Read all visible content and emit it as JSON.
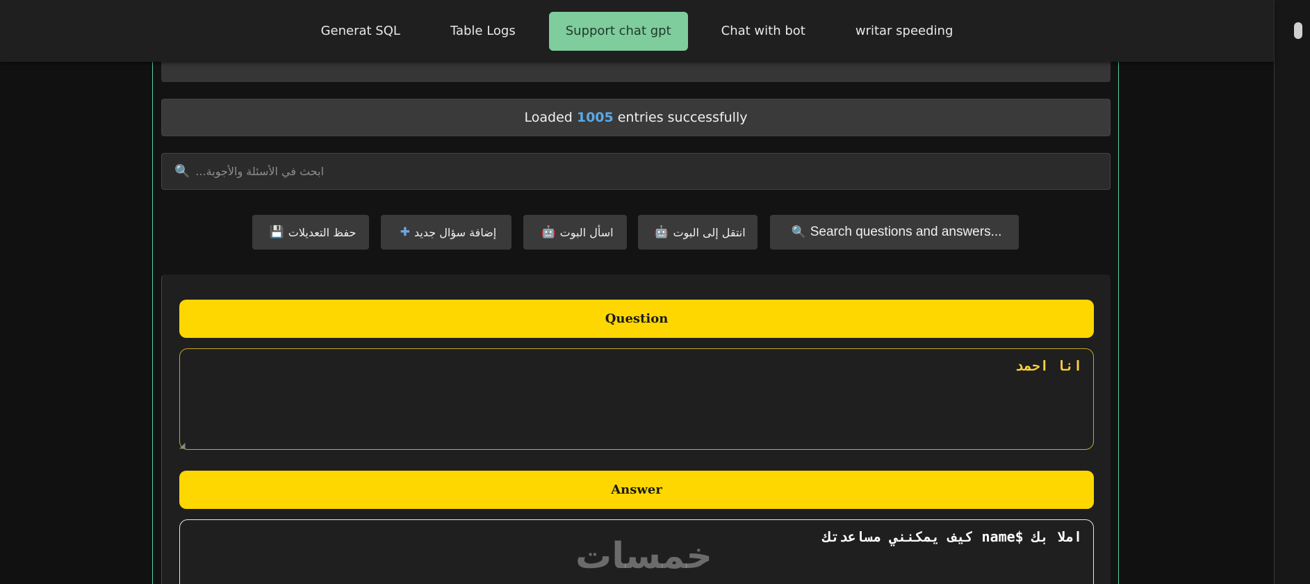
{
  "nav": {
    "tabs": [
      {
        "label": "Generat SQL",
        "active": false
      },
      {
        "label": "Table Logs",
        "active": false
      },
      {
        "label": "Support chat gpt",
        "active": true
      },
      {
        "label": "Chat with bot",
        "active": false
      },
      {
        "label": "writar speeding",
        "active": false
      }
    ]
  },
  "status": {
    "prefix": "Loaded",
    "count": "1005",
    "suffix": "entries successfully"
  },
  "search": {
    "placeholder": "ابحث في الأسئلة والأجوبة...",
    "icon": "search-icon"
  },
  "toolbar": {
    "search_label": "Search questions and answers...",
    "goto_bot_label": "انتقل إلى البوت",
    "ask_bot_label": "اسأل البوت",
    "add_question_label": "إضافة سؤال جديد",
    "save_label": "حفظ التعديلات"
  },
  "entry": {
    "question_header": "Question",
    "question_text": "انا احمد",
    "answer_header": "Answer",
    "answer_text": "املا بك $name كيف يمكنني مساعدتك"
  },
  "watermark": {
    "text": "خمسات"
  },
  "colors": {
    "accent_green": "#7fcc9c",
    "header_yellow": "#ffd700",
    "count_blue": "#5aa9e6",
    "question_text": "#ffd23d"
  }
}
